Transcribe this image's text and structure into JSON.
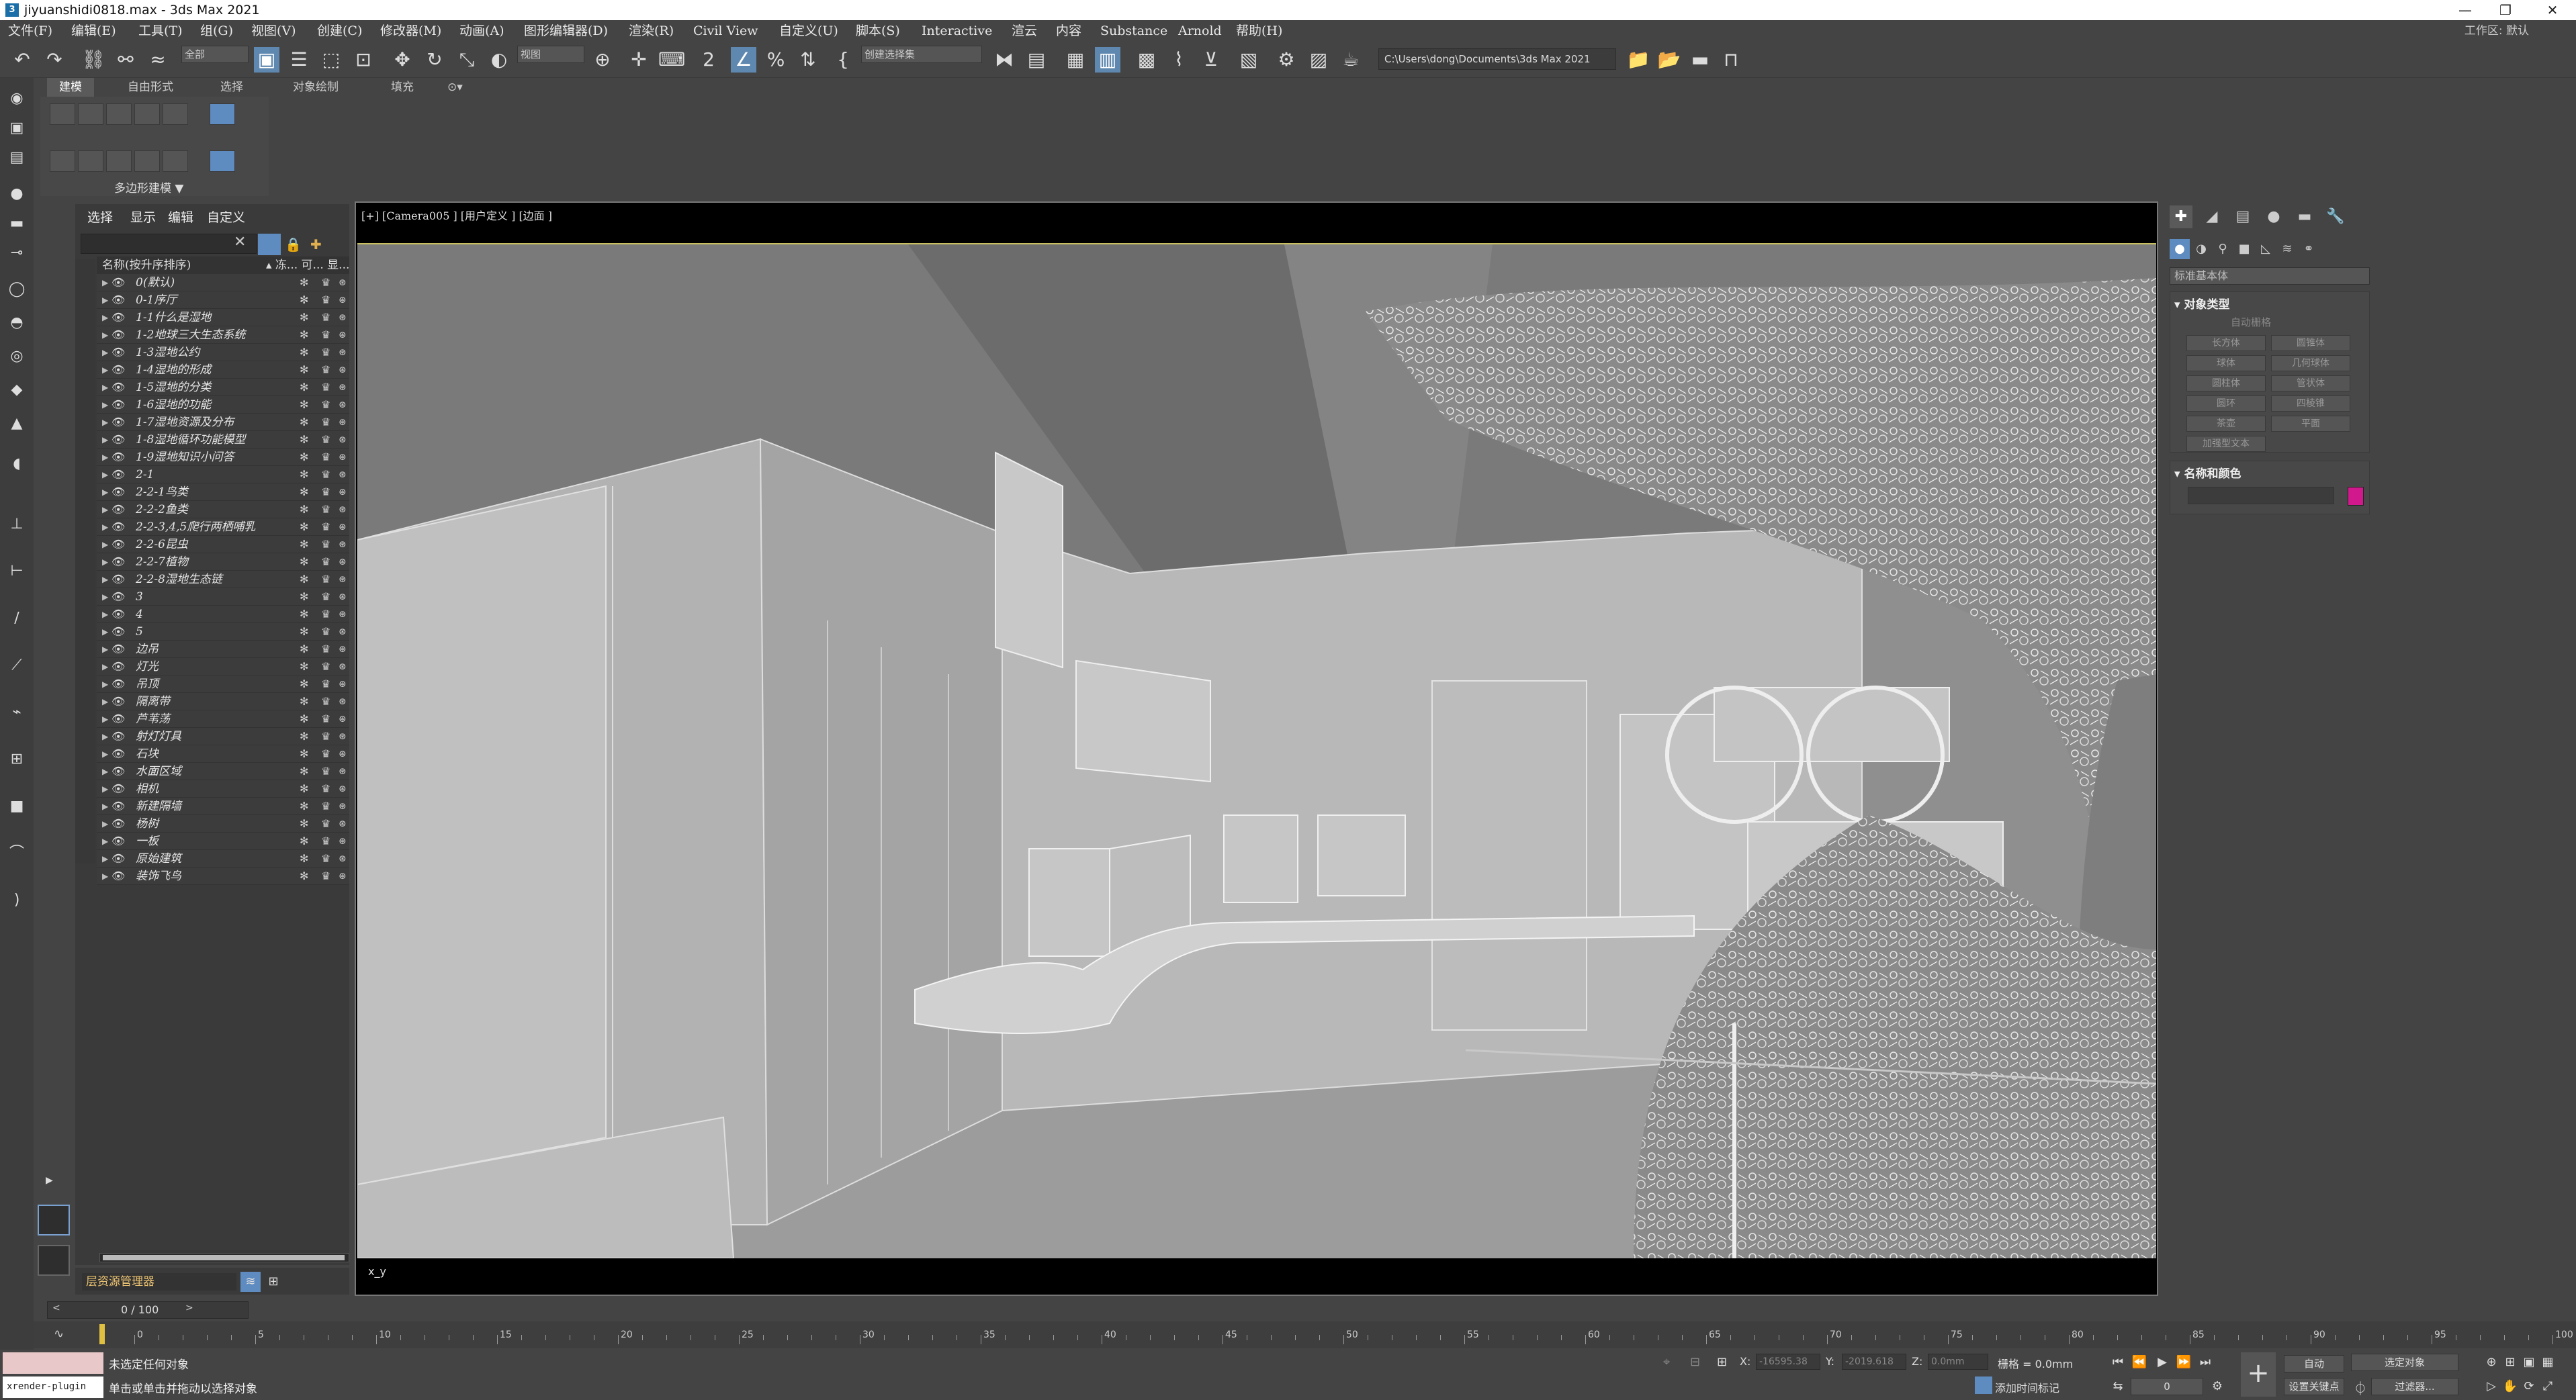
{
  "window": {
    "title": "jiyuanshidi0818.max - 3ds Max 2021"
  },
  "menu": [
    "文件(F)",
    "编辑(E)",
    "工具(T)",
    "组(G)",
    "视图(V)",
    "创建(C)",
    "修改器(M)",
    "动画(A)",
    "图形编辑器(D)",
    "渲染(R)",
    "Civil View",
    "自定义(U)",
    "脚本(S)",
    "Interactive",
    "渲云",
    "内容",
    "Substance",
    "Arnold",
    "帮助(H)"
  ],
  "workspace": {
    "label": "工作区:",
    "value": "默认"
  },
  "toolbar": {
    "filter_value": "全部",
    "refcoord_value": "视图",
    "selection_set_placeholder": "创建选择集",
    "project_path": "C:\\Users\\dong\\Documents\\3ds Max 2021"
  },
  "ribbon": {
    "tabs": [
      "建模",
      "自由形式",
      "选择",
      "对象绘制",
      "填充"
    ],
    "active_tab": "建模",
    "group_label": "多边形建模 ▼"
  },
  "scene_explorer": {
    "tabs": [
      "选择",
      "显示",
      "编辑",
      "自定义"
    ],
    "header": "名称(按升序排序)",
    "header_cols": "▴ 冻... 可... 显...",
    "rows": [
      "0(默认)",
      "0-1序厅",
      "1-1什么是湿地",
      "1-2地球三大生态系统",
      "1-3湿地公约",
      "1-4湿地的形成",
      "1-5湿地的分类",
      "1-6湿地的功能",
      "1-7湿地资源及分布",
      "1-8湿地循环功能模型",
      "1-9湿地知识小问答",
      "2-1",
      "2-2-1鸟类",
      "2-2-2鱼类",
      "2-2-3,4,5爬行两栖哺乳",
      "2-2-6昆虫",
      "2-2-7植物",
      "2-2-8湿地生态链",
      "3",
      "4",
      "5",
      "边吊",
      "灯光",
      "吊顶",
      "隔离带",
      "芦苇荡",
      "射灯灯具",
      "石块",
      "水面区域",
      "相机",
      "新建隔墙",
      "杨树",
      "一板",
      "原始建筑",
      "装饰飞鸟"
    ]
  },
  "layer_manager": {
    "label": "层资源管理器"
  },
  "viewport": {
    "label": "[+] [Camera005 ] [用户定义 ] [边面 ]",
    "axis_label": "x_y"
  },
  "command_panel": {
    "dropdown": "标准基本体",
    "rollout_object_type": "对象类型",
    "autogrid": "自动栅格",
    "object_buttons": [
      "长方体",
      "圆锥体",
      "球体",
      "几何球体",
      "圆柱体",
      "管状体",
      "圆环",
      "四棱锥",
      "茶壶",
      "平面",
      "加强型文本"
    ],
    "rollout_name_color": "名称和颜色",
    "object_color": "#d1188c"
  },
  "timeline": {
    "frame": "0 / 100",
    "ticks": [
      "0",
      "5",
      "10",
      "15",
      "20",
      "25",
      "30",
      "35",
      "40",
      "45",
      "50",
      "55",
      "60",
      "65",
      "70",
      "75",
      "80",
      "85",
      "90",
      "95",
      "100"
    ]
  },
  "status": {
    "maxscript": "xrender-plugin",
    "line1": "未选定任何对象",
    "line2": "单击或单击并拖动以选择对象",
    "x_label": "X:",
    "x_value": "-16595.38",
    "y_label": "Y:",
    "y_value": "-2019.618",
    "z_label": "Z:",
    "z_value": "0.0mm",
    "grid": "栅格 = 0.0mm",
    "add_time_tag": "添加时间标记",
    "auto_key": "自动",
    "selected_dropdown": "选定对象",
    "set_key": "设置关键点",
    "filters": "过滤器...",
    "frame_spinner": "0"
  },
  "colors": {
    "accent": "#5e8bc0",
    "viewport_border": "#c8c060"
  }
}
